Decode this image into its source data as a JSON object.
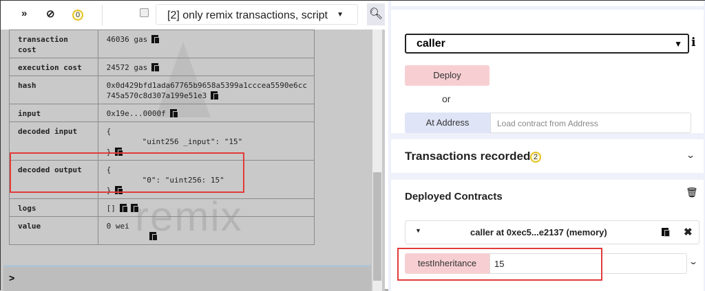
{
  "terminal": {
    "toolbar": {
      "pending_count": "0",
      "filter_label": "[2] only remix transactions, script"
    },
    "rows": [
      {
        "key": "transaction cost",
        "lines": [
          "46036 gas"
        ]
      },
      {
        "key": "execution cost",
        "lines": [
          "24572 gas"
        ]
      },
      {
        "key": "hash",
        "lines": [
          "0x0d429bfd1ada67765b9658a5399a1cccea5590e6cc",
          "745a570c8d307a199e51e3"
        ]
      },
      {
        "key": "input",
        "lines": [
          "0x19e...0000f"
        ]
      },
      {
        "key": "decoded input",
        "lines": [
          "{",
          "\"uint256 _input\": \"15\"",
          "}"
        ]
      },
      {
        "key": "decoded output",
        "lines": [
          "{",
          "\"0\": \"uint256: 15\"",
          "}"
        ]
      },
      {
        "key": "logs",
        "lines": [
          "[]"
        ]
      },
      {
        "key": "value",
        "lines": [
          "0 wei"
        ]
      }
    ],
    "watermark": "remix",
    "prompt": ">"
  },
  "deploy_panel": {
    "contract_select": "caller",
    "deploy_label": "Deploy",
    "or_label": "or",
    "at_address_label": "At Address",
    "address_placeholder": "Load contract from Address",
    "transactions_recorded_label": "Transactions recorded:",
    "transactions_recorded_count": "2",
    "deployed_contracts_label": "Deployed Contracts",
    "instance_label": "caller at 0xec5...e2137 (memory)",
    "function_label": "testInheritance",
    "function_input": "15"
  },
  "colors": {
    "highlight": "#e23a3a",
    "deploy": "#f7cfd2",
    "at_address": "#dfe4f7",
    "badge": "#e6c21e"
  }
}
